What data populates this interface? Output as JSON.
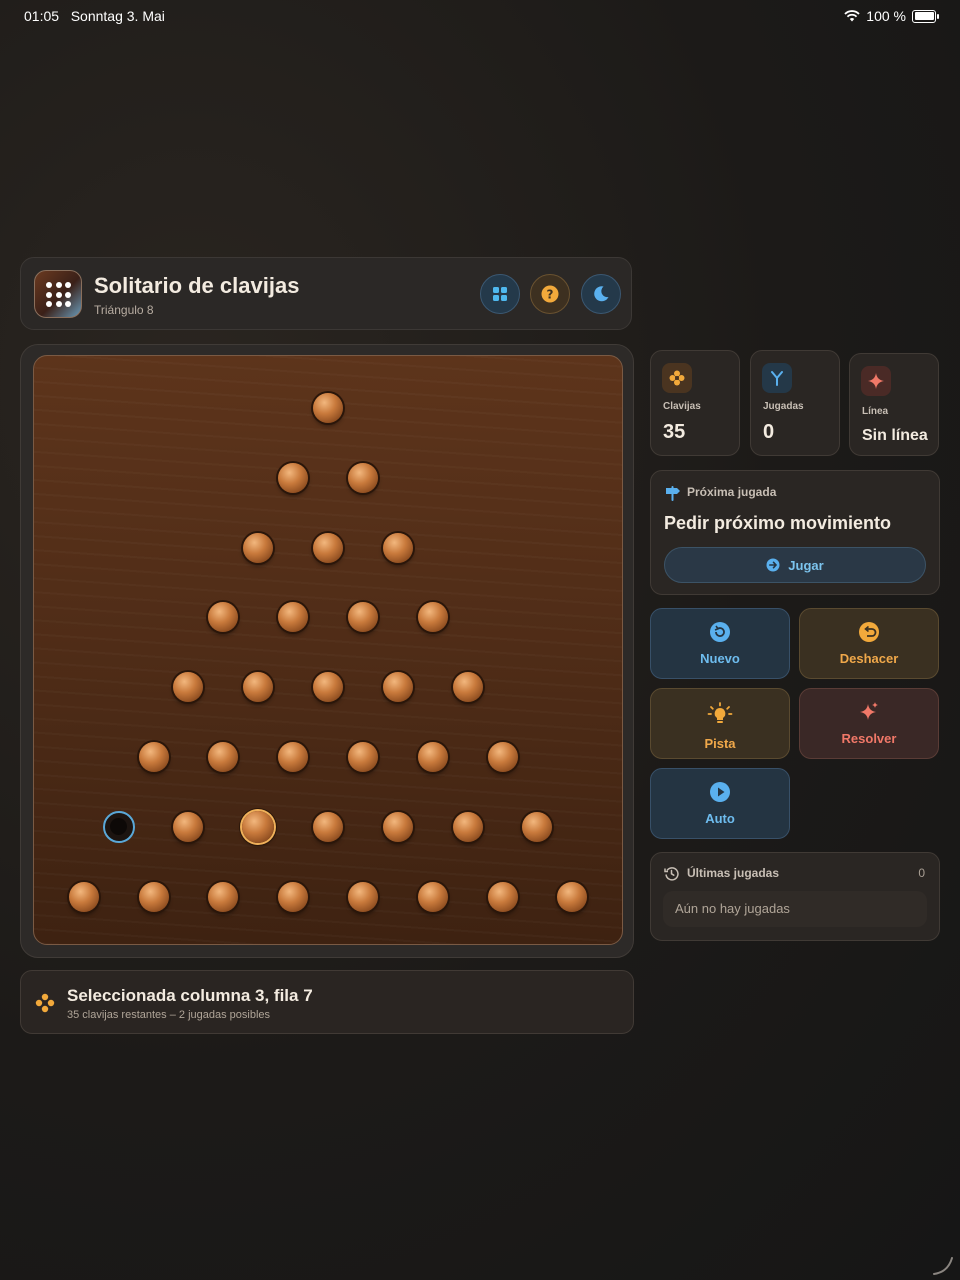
{
  "status_bar": {
    "time": "01:05",
    "date": "Sonntag 3. Mai",
    "battery": "100 %"
  },
  "header": {
    "title": "Solitario de clavijas",
    "subtitle": "Triángulo 8"
  },
  "board": {
    "rows": [
      {
        "pegs": 1
      },
      {
        "pegs": 2
      },
      {
        "pegs": 3
      },
      {
        "pegs": 4
      },
      {
        "pegs": 5
      },
      {
        "pegs": 6
      },
      {
        "pegs": 7
      },
      {
        "pegs": 8
      }
    ],
    "empty_hole": {
      "row": 7,
      "column": 1
    },
    "selected": {
      "row": 7,
      "column": 3
    }
  },
  "selection": {
    "title": "Seleccionada columna 3, fila 7",
    "subtitle": "35 clavijas restantes – 2 jugadas posibles"
  },
  "stats": {
    "pegs": {
      "label": "Clavijas",
      "value": "35"
    },
    "moves": {
      "label": "Jugadas",
      "value": "0"
    },
    "line": {
      "label": "Línea",
      "value": "Sin línea"
    }
  },
  "next_move": {
    "label": "Próxima jugada",
    "title": "Pedir próximo movimiento",
    "button": "Jugar"
  },
  "actions": {
    "new": "Nuevo",
    "undo": "Deshacer",
    "hint": "Pista",
    "solve": "Resolver",
    "auto": "Auto"
  },
  "history": {
    "label": "Últimas jugadas",
    "count": "0",
    "empty": "Aún no hay jugadas"
  },
  "colors": {
    "accent_blue": "#6ebcee",
    "accent_amber": "#f0a84a",
    "accent_red": "#f07868",
    "wood": "#4f2c17"
  }
}
